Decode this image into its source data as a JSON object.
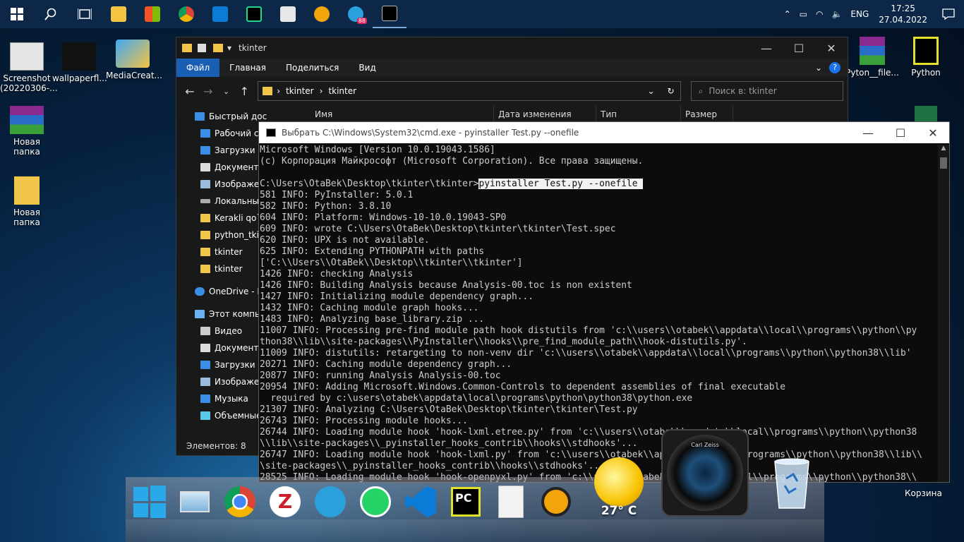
{
  "taskbar": {
    "clock_time": "17:25",
    "clock_date": "27.04.2022",
    "language": "ENG",
    "telegram_badge": "88"
  },
  "desktop_icons": [
    {
      "label": "Screenshot (20220306-..."
    },
    {
      "label": "wallpaperfl..."
    },
    {
      "label": "MediaCreat..."
    },
    {
      "label": "Новая папка"
    },
    {
      "label": "Новая папка"
    },
    {
      "label": "Pyton__file..."
    },
    {
      "label": "Python"
    },
    {
      "label": "Корзина"
    }
  ],
  "explorer": {
    "title": "tkinter",
    "ribbon": [
      "Файл",
      "Главная",
      "Поделиться",
      "Вид"
    ],
    "breadcrumb": [
      "tkinter",
      "tkinter"
    ],
    "search_placeholder": "Поиск в: tkinter",
    "columns": [
      "Имя",
      "Дата изменения",
      "Тип",
      "Размер"
    ],
    "nav_items": [
      "Быстрый дос",
      "Рабочий сто",
      "Загрузки",
      "Документы",
      "Изображени",
      "Локальный",
      "Kerakli qo`lla",
      "python_tkint",
      "tkinter",
      "tkinter",
      "OneDrive - Pe",
      "Этот компью",
      "Видео",
      "Документы",
      "Загрузки",
      "Изображени",
      "Музыка",
      "Объемные"
    ],
    "status": "Элементов: 8"
  },
  "cmd": {
    "title": "Выбрать C:\\Windows\\System32\\cmd.exe - pyinstaller  Test.py --onefile",
    "prompt": "C:\\Users\\OtaBek\\Desktop\\tkinter\\tkinter>",
    "command": "pyinstaller Test.py --onefile ",
    "lines_before": [
      "Microsoft Windows [Version 10.0.19043.1586]",
      "(c) Корпорация Майкрософт (Microsoft Corporation). Все права защищены.",
      ""
    ],
    "lines_after": [
      "581 INFO: PyInstaller: 5.0.1",
      "582 INFO: Python: 3.8.10",
      "604 INFO: Platform: Windows-10-10.0.19043-SP0",
      "609 INFO: wrote C:\\Users\\OtaBek\\Desktop\\tkinter\\tkinter\\Test.spec",
      "620 INFO: UPX is not available.",
      "625 INFO: Extending PYTHONPATH with paths",
      "['C:\\\\Users\\\\OtaBek\\\\Desktop\\\\tkinter\\\\tkinter']",
      "1426 INFO: checking Analysis",
      "1426 INFO: Building Analysis because Analysis-00.toc is non existent",
      "1427 INFO: Initializing module dependency graph...",
      "1432 INFO: Caching module graph hooks...",
      "1483 INFO: Analyzing base_library.zip ...",
      "11007 INFO: Processing pre-find module path hook distutils from 'c:\\\\users\\\\otabek\\\\appdata\\\\local\\\\programs\\\\python\\\\py",
      "thon38\\\\lib\\\\site-packages\\\\PyInstaller\\\\hooks\\\\pre_find_module_path\\\\hook-distutils.py'.",
      "11009 INFO: distutils: retargeting to non-venv dir 'c:\\\\users\\\\otabek\\\\appdata\\\\local\\\\programs\\\\python\\\\python38\\\\lib'",
      "20271 INFO: Caching module dependency graph...",
      "20877 INFO: running Analysis Analysis-00.toc",
      "20954 INFO: Adding Microsoft.Windows.Common-Controls to dependent assemblies of final executable",
      "  required by c:\\users\\otabek\\appdata\\local\\programs\\python\\python38\\python.exe",
      "21307 INFO: Analyzing C:\\Users\\OtaBek\\Desktop\\tkinter\\tkinter\\Test.py",
      "26743 INFO: Processing module hooks...",
      "26744 INFO: Loading module hook 'hook-lxml.etree.py' from 'c:\\\\users\\\\otabek\\\\appdata\\\\local\\\\programs\\\\python\\\\python38",
      "\\\\lib\\\\site-packages\\\\_pyinstaller_hooks_contrib\\\\hooks\\\\stdhooks'...",
      "26747 INFO: Loading module hook 'hook-lxml.py' from 'c:\\\\users\\\\otabek\\\\appdata\\\\local\\\\programs\\\\python\\\\python38\\\\lib\\\\",
      "\\site-packages\\\\_pyinstaller_hooks_contrib\\\\hooks\\\\stdhooks'...",
      "28525 INFO: Loading module hook 'hook-openpyxl.py' from 'c:\\\\users\\\\otabek\\\\appdata\\\\local\\\\programs\\\\python\\\\python38\\\\"
    ]
  },
  "dock": {
    "temperature": "27° C",
    "lens_brand": "Carl Zeiss"
  }
}
